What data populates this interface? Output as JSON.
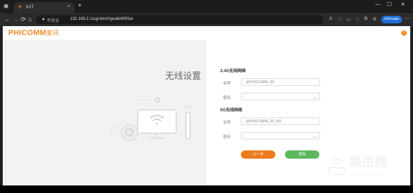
{
  "browser": {
    "tab": {
      "title": "K2T",
      "close": "×"
    },
    "new_tab": "+",
    "address": {
      "security_label": "不安全",
      "url": "192.168.2.1/cgi-bin/#/guideWifiSet"
    },
    "profile_label": "InPrivate",
    "nav": {
      "back": "←",
      "forward": "→",
      "refresh": "⟳",
      "home": "⌂"
    },
    "window_controls": {
      "minimize": "—",
      "maximize": "☐",
      "close": "✕"
    },
    "menu": "···"
  },
  "page": {
    "logo_text": "PHICOMM",
    "logo_cn": "斐讯",
    "help_icon_text": "?",
    "title": "无线设置",
    "wifi24": {
      "section_title": "2.4G无线网络",
      "name_label": "名称",
      "name_value": "@PHICOMM_20",
      "password_label": "密码",
      "password_value": ""
    },
    "wifi5": {
      "section_title": "5G无线网络",
      "name_label": "名称",
      "name_value": "@PHICOMM_20_5G",
      "password_label": "密码",
      "password_value": ""
    },
    "buttons": {
      "prev": "上一步",
      "save": "保存"
    }
  },
  "watermark": {
    "cn": "路由器",
    "en": "luyouqi.com"
  },
  "colors": {
    "brand_orange": "#f08a24",
    "prev_button": "#f07a1e",
    "save_button": "#5cb85c",
    "inprivate": "#1e6fd9"
  }
}
